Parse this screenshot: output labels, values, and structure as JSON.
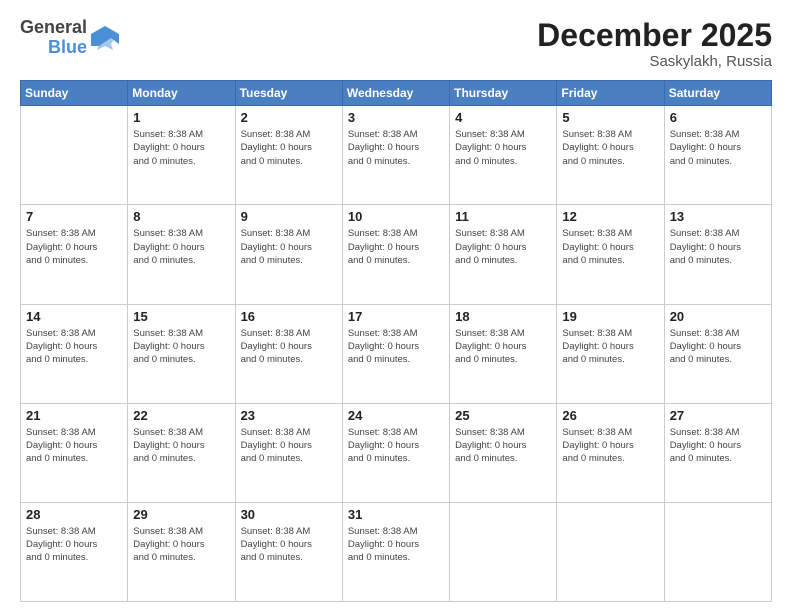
{
  "logo": {
    "text_general": "General",
    "text_blue": "Blue"
  },
  "title": {
    "month_year": "December 2025",
    "location": "Saskylakh, Russia"
  },
  "days_of_week": [
    "Sunday",
    "Monday",
    "Tuesday",
    "Wednesday",
    "Thursday",
    "Friday",
    "Saturday"
  ],
  "day_info_template": "Sunset: 8:38 AM\nDaylight: 0 hours and 0 minutes.",
  "weeks": [
    {
      "days": [
        {
          "number": "",
          "empty": true
        },
        {
          "number": "1",
          "info": "Sunset: 8:38 AM\nDaylight: 0 hours and 0 minutes."
        },
        {
          "number": "2",
          "info": "Sunset: 8:38 AM\nDaylight: 0 hours and 0 minutes."
        },
        {
          "number": "3",
          "info": "Sunset: 8:38 AM\nDaylight: 0 hours and 0 minutes."
        },
        {
          "number": "4",
          "info": "Sunset: 8:38 AM\nDaylight: 0 hours and 0 minutes."
        },
        {
          "number": "5",
          "info": "Sunset: 8:38 AM\nDaylight: 0 hours and 0 minutes."
        },
        {
          "number": "6",
          "info": "Sunset: 8:38 AM\nDaylight: 0 hours and 0 minutes."
        }
      ]
    },
    {
      "days": [
        {
          "number": "7",
          "info": "Sunset: 8:38 AM\nDaylight: 0 hours and 0 minutes."
        },
        {
          "number": "8",
          "info": "Sunset: 8:38 AM\nDaylight: 0 hours and 0 minutes."
        },
        {
          "number": "9",
          "info": "Sunset: 8:38 AM\nDaylight: 0 hours and 0 minutes."
        },
        {
          "number": "10",
          "info": "Sunset: 8:38 AM\nDaylight: 0 hours and 0 minutes."
        },
        {
          "number": "11",
          "info": "Sunset: 8:38 AM\nDaylight: 0 hours and 0 minutes."
        },
        {
          "number": "12",
          "info": "Sunset: 8:38 AM\nDaylight: 0 hours and 0 minutes."
        },
        {
          "number": "13",
          "info": "Sunset: 8:38 AM\nDaylight: 0 hours and 0 minutes."
        }
      ]
    },
    {
      "days": [
        {
          "number": "14",
          "info": "Sunset: 8:38 AM\nDaylight: 0 hours and 0 minutes."
        },
        {
          "number": "15",
          "info": "Sunset: 8:38 AM\nDaylight: 0 hours and 0 minutes."
        },
        {
          "number": "16",
          "info": "Sunset: 8:38 AM\nDaylight: 0 hours and 0 minutes."
        },
        {
          "number": "17",
          "info": "Sunset: 8:38 AM\nDaylight: 0 hours and 0 minutes."
        },
        {
          "number": "18",
          "info": "Sunset: 8:38 AM\nDaylight: 0 hours and 0 minutes."
        },
        {
          "number": "19",
          "info": "Sunset: 8:38 AM\nDaylight: 0 hours and 0 minutes."
        },
        {
          "number": "20",
          "info": "Sunset: 8:38 AM\nDaylight: 0 hours and 0 minutes."
        }
      ]
    },
    {
      "days": [
        {
          "number": "21",
          "info": "Sunset: 8:38 AM\nDaylight: 0 hours and 0 minutes."
        },
        {
          "number": "22",
          "info": "Sunset: 8:38 AM\nDaylight: 0 hours and 0 minutes."
        },
        {
          "number": "23",
          "info": "Sunset: 8:38 AM\nDaylight: 0 hours and 0 minutes."
        },
        {
          "number": "24",
          "info": "Sunset: 8:38 AM\nDaylight: 0 hours and 0 minutes."
        },
        {
          "number": "25",
          "info": "Sunset: 8:38 AM\nDaylight: 0 hours and 0 minutes."
        },
        {
          "number": "26",
          "info": "Sunset: 8:38 AM\nDaylight: 0 hours and 0 minutes."
        },
        {
          "number": "27",
          "info": "Sunset: 8:38 AM\nDaylight: 0 hours and 0 minutes."
        }
      ]
    },
    {
      "days": [
        {
          "number": "28",
          "info": "Sunset: 8:38 AM\nDaylight: 0 hours and 0 minutes."
        },
        {
          "number": "29",
          "info": "Sunset: 8:38 AM\nDaylight: 0 hours and 0 minutes."
        },
        {
          "number": "30",
          "info": "Sunset: 8:38 AM\nDaylight: 0 hours and 0 minutes."
        },
        {
          "number": "31",
          "info": "Sunset: 8:38 AM\nDaylight: 0 hours and 0 minutes."
        },
        {
          "number": "",
          "empty": true
        },
        {
          "number": "",
          "empty": true
        },
        {
          "number": "",
          "empty": true
        }
      ]
    }
  ]
}
